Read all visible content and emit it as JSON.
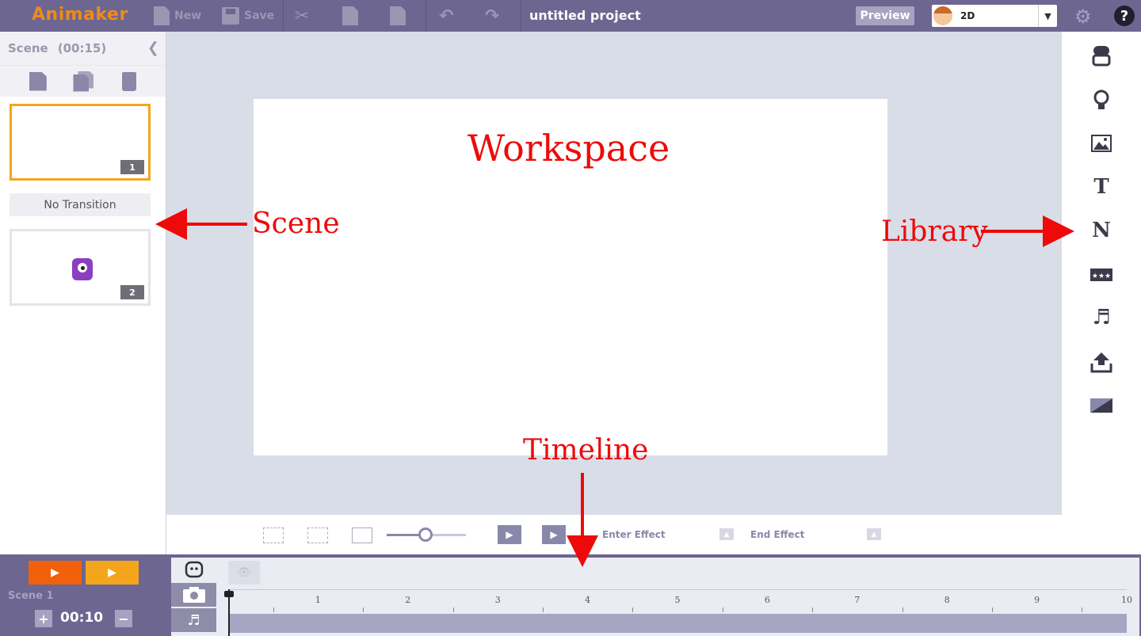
{
  "app": {
    "logo": "Animaker",
    "project_title": "untitled project"
  },
  "toolbar": {
    "new_label": "New",
    "save_label": "Save",
    "preview_label": "Preview",
    "mode_label": "2D"
  },
  "scene_panel": {
    "title": "Scene",
    "duration": "(00:15)",
    "scenes": [
      {
        "number": "1"
      },
      {
        "number": "2"
      }
    ],
    "transition_label": "No Transition"
  },
  "bottom_tools": {
    "enter_effect_label": "Enter Effect",
    "end_effect_label": "End Effect"
  },
  "timeline": {
    "scene_label": "Scene 1",
    "duration": "00:10",
    "plus": "+",
    "minus": "−",
    "ticks": [
      "1",
      "2",
      "3",
      "4",
      "5",
      "6",
      "7",
      "8",
      "9",
      "10"
    ]
  },
  "annotations": {
    "workspace": "Workspace",
    "scene": "Scene",
    "library": "Library",
    "timeline": "Timeline"
  },
  "colors": {
    "topbar": "#6c6690",
    "accent_orange": "#f2600c",
    "accent_yellow": "#f5a51c",
    "annotation_red": "#ee0a0a"
  },
  "icons": {
    "library": [
      "character-icon",
      "lightbulb-icon",
      "image-icon",
      "text-icon",
      "number-icon",
      "stars-icon",
      "music-icon",
      "upload-icon",
      "background-icon"
    ]
  }
}
